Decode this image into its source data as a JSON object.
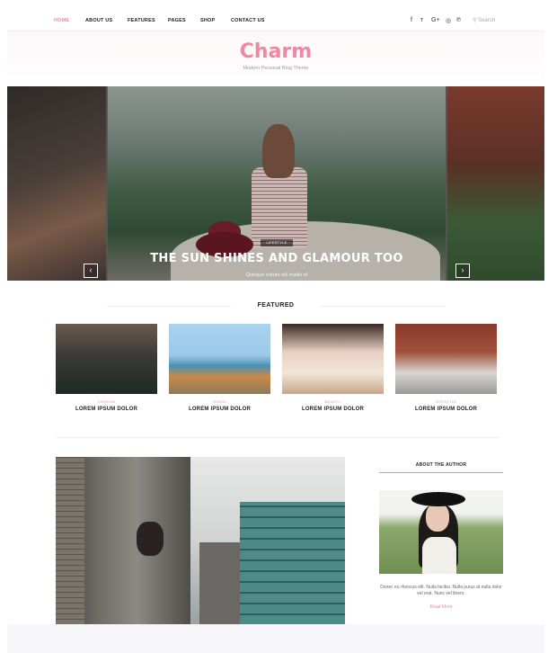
{
  "nav": {
    "items": [
      {
        "label": "HOME",
        "active": true
      },
      {
        "label": "ABOUT US",
        "active": false
      },
      {
        "label": "FEATURES",
        "active": false
      },
      {
        "label": "PAGES",
        "active": false
      },
      {
        "label": "SHOP",
        "active": false
      },
      {
        "label": "CONTACT US",
        "active": false
      }
    ],
    "social_icons": [
      "facebook-icon",
      "twitter-icon",
      "google-plus-icon",
      "instagram-icon",
      "pinterest-icon"
    ],
    "social_glyphs": [
      "f",
      "ᴛ",
      "G+",
      "◎",
      "℗"
    ],
    "search_placeholder": "Search"
  },
  "header": {
    "logo": "Charm",
    "tagline": "Modern Personal Blog Theme"
  },
  "slider": {
    "category": "LIFESTYLE",
    "title": "THE SUN SHINES AND GLAMOUR TOO",
    "excerpt": "Quisque rutrum elit mattis et",
    "prev_arrow": "‹",
    "next_arrow": "›"
  },
  "featured": {
    "section_title": "FEATURED",
    "cards": [
      {
        "category": "FASHION",
        "title": "LOREM IPSUM DOLOR"
      },
      {
        "category": "TRAVEL",
        "title": "LOREM IPSUM DOLOR"
      },
      {
        "category": "BEAUTY",
        "title": "LOREM IPSUM DOLOR"
      },
      {
        "category": "LIFESTYLE",
        "title": "LOREM IPSUM DOLOR"
      }
    ]
  },
  "sidebar": {
    "about_title": "ABOUT THE AUTHOR",
    "bio": "Donec eu rhoncus elit. Nulla facilisi. Nulla purus at nulla dolor vel erat. Nunc vel libero.",
    "read_more": "Read More"
  },
  "colors": {
    "accent": "#ec8aa5",
    "text": "#222222"
  }
}
